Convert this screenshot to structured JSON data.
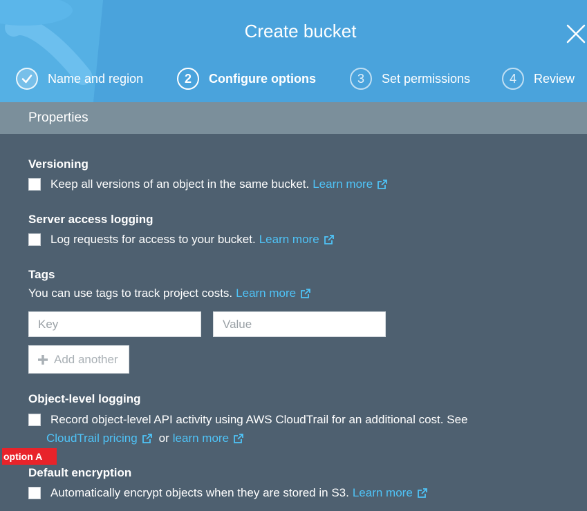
{
  "dialog": {
    "title": "Create bucket",
    "close_icon": "close-icon",
    "steps": [
      {
        "number": "",
        "label": "Name and region",
        "status": "completed",
        "icon": "checkmark-icon"
      },
      {
        "number": "2",
        "label": "Configure options",
        "status": "active"
      },
      {
        "number": "3",
        "label": "Set permissions",
        "status": "pending"
      },
      {
        "number": "4",
        "label": "Review",
        "status": "pending"
      }
    ]
  },
  "properties": {
    "title": "Properties",
    "versioning": {
      "title": "Versioning",
      "text": "Keep all versions of an object in the same bucket.",
      "link": "Learn more",
      "checked": false
    },
    "access_logging": {
      "title": "Server access logging",
      "text": "Log requests for access to your bucket.",
      "link": "Learn more",
      "checked": false
    },
    "tags": {
      "title": "Tags",
      "text": "You can use tags to track project costs.",
      "link": "Learn more",
      "key_placeholder": "Key",
      "value_placeholder": "Value",
      "add_label": "Add another"
    },
    "object_logging": {
      "title": "Object-level logging",
      "text": "Record object-level API activity using AWS CloudTrail for an additional cost. See",
      "pricing_link": "CloudTrail pricing",
      "or_text": "or",
      "learn_link": "learn more",
      "checked": false
    },
    "encryption": {
      "title": "Default encryption",
      "text": "Automatically encrypt objects when they are stored in S3.",
      "link": "Learn more",
      "checked": false
    }
  },
  "annotation": {
    "label": "option A",
    "color": "#e8232a"
  },
  "colors": {
    "header": "#4aa3dc",
    "properties_bar": "#7b8f9b",
    "body": "#4e6070",
    "link": "#4fc3f7"
  }
}
